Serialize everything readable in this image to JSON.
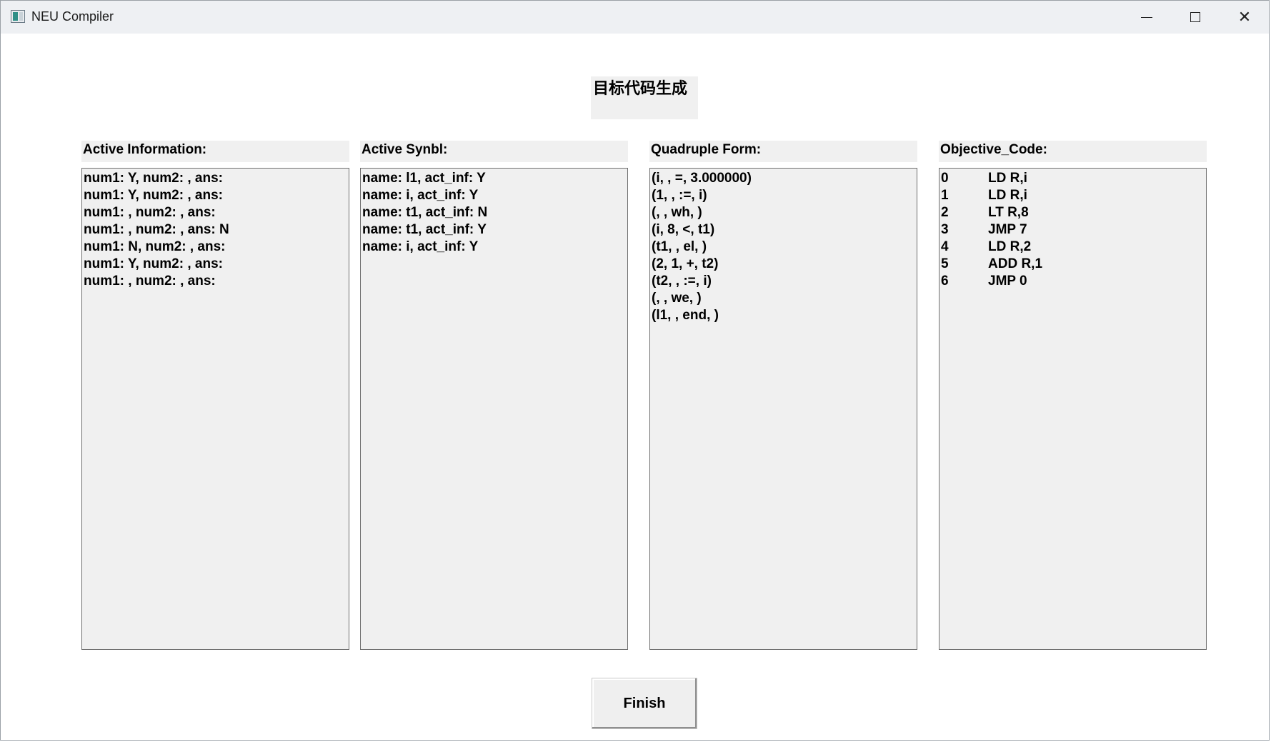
{
  "window": {
    "title": "NEU Compiler",
    "icon": "app-window-icon"
  },
  "heading": "目标代码生成",
  "columns": {
    "active_information": {
      "label": "Active Information:",
      "rows": [
        "num1: Y, num2: , ans:",
        "num1: Y, num2: , ans:",
        "num1: , num2: , ans:",
        "num1: , num2: , ans: N",
        "num1: N, num2: , ans:",
        "num1: Y, num2: , ans:",
        "num1: , num2: , ans:"
      ]
    },
    "active_symbol": {
      "label": "Active Synbl:",
      "rows": [
        "name: l1, act_inf: Y",
        "name: i, act_inf: Y",
        "name: t1, act_inf: N",
        "name: t1, act_inf: Y",
        "name: i, act_inf: Y"
      ]
    },
    "quadruple_form": {
      "label": "Quadruple Form:",
      "rows": [
        "(i, , =, 3.000000)",
        "(1, , :=, i)",
        "(, , wh, )",
        "(i, 8, <, t1)",
        "(t1, , el, )",
        "(2, 1, +, t2)",
        "(t2, , :=, i)",
        "(, , we, )",
        "(l1, , end, )"
      ]
    },
    "objective_code": {
      "label": "Objective_Code:",
      "rows": [
        {
          "index": "0",
          "code": "LD R,i"
        },
        {
          "index": "1",
          "code": "LD R,i"
        },
        {
          "index": "2",
          "code": "LT R,8"
        },
        {
          "index": "3",
          "code": "JMP 7"
        },
        {
          "index": "4",
          "code": "LD R,2"
        },
        {
          "index": "5",
          "code": "ADD R,1"
        },
        {
          "index": "6",
          "code": "JMP 0"
        }
      ]
    }
  },
  "finish_button": "Finish"
}
